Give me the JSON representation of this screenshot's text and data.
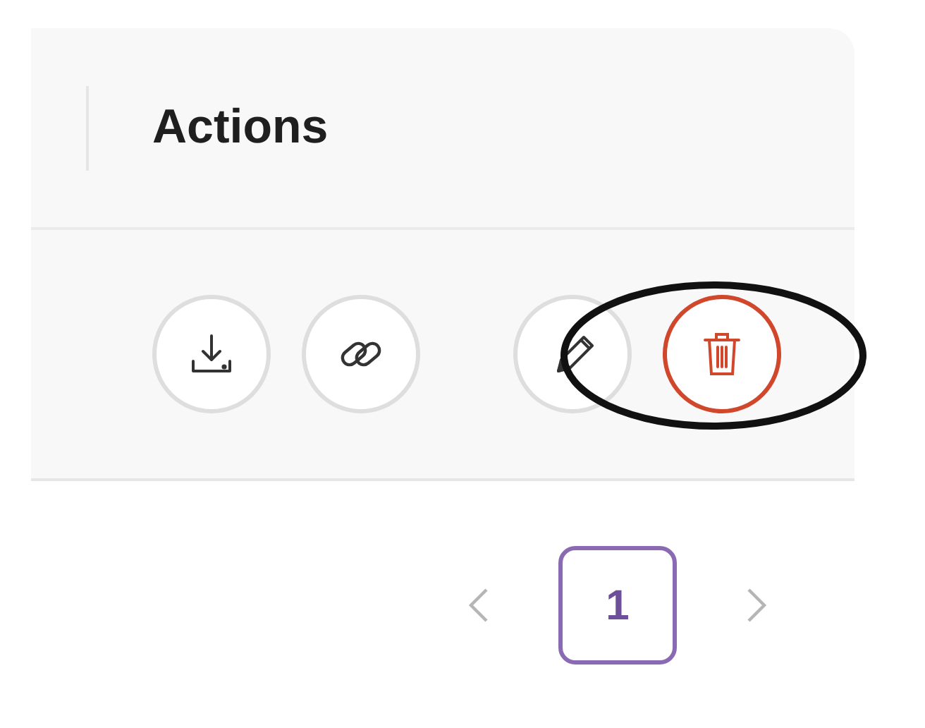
{
  "header": {
    "title": "Actions"
  },
  "actions": [
    {
      "kind": "download",
      "highlighted": false
    },
    {
      "kind": "link",
      "highlighted": false
    },
    {
      "kind": "edit",
      "highlighted": false
    },
    {
      "kind": "delete",
      "highlighted": true
    }
  ],
  "pagination": {
    "pages": [
      {
        "label": "1",
        "selected": true
      }
    ]
  }
}
